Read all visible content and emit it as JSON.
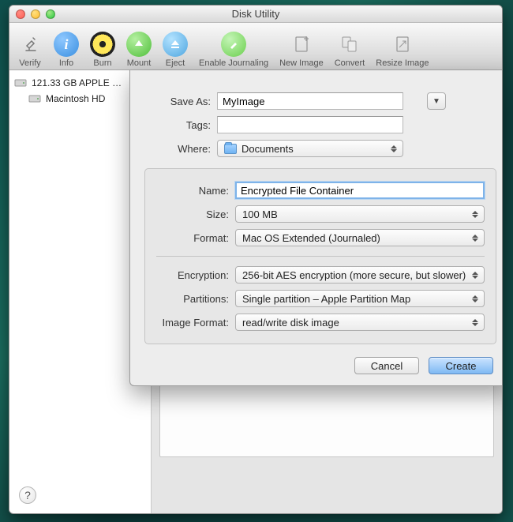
{
  "window": {
    "title": "Disk Utility"
  },
  "toolbar": [
    {
      "name": "verify-button",
      "label": "Verify",
      "icon": "microscope"
    },
    {
      "name": "info-button",
      "label": "Info",
      "icon": "info"
    },
    {
      "name": "burn-button",
      "label": "Burn",
      "icon": "burn"
    },
    {
      "name": "mount-button",
      "label": "Mount",
      "icon": "mount"
    },
    {
      "name": "eject-button",
      "label": "Eject",
      "icon": "eject"
    },
    {
      "name": "enable-journaling-button",
      "label": "Enable Journaling",
      "icon": "journal"
    },
    {
      "name": "new-image-button",
      "label": "New Image",
      "icon": "newimage"
    },
    {
      "name": "convert-button",
      "label": "Convert",
      "icon": "convert"
    },
    {
      "name": "resize-image-button",
      "label": "Resize Image",
      "icon": "resize"
    }
  ],
  "sidebar": {
    "items": [
      {
        "label": "121.33 GB APPLE …",
        "icon": "disk"
      },
      {
        "label": "Macintosh HD",
        "icon": "disk",
        "indent": true
      }
    ]
  },
  "sheet": {
    "save_as": {
      "label": "Save As:",
      "value": "MyImage"
    },
    "tags": {
      "label": "Tags:",
      "value": ""
    },
    "where": {
      "label": "Where:",
      "value": "Documents"
    },
    "name": {
      "label": "Name:",
      "value": "Encrypted File Container"
    },
    "size": {
      "label": "Size:",
      "value": "100 MB"
    },
    "format": {
      "label": "Format:",
      "value": "Mac OS Extended (Journaled)"
    },
    "encryption": {
      "label": "Encryption:",
      "value": "256-bit AES encryption (more secure, but slower)"
    },
    "partitions": {
      "label": "Partitions:",
      "value": "Single partition – Apple Partition Map"
    },
    "image_format": {
      "label": "Image Format:",
      "value": "read/write disk image"
    },
    "cancel": "Cancel",
    "create": "Create"
  }
}
